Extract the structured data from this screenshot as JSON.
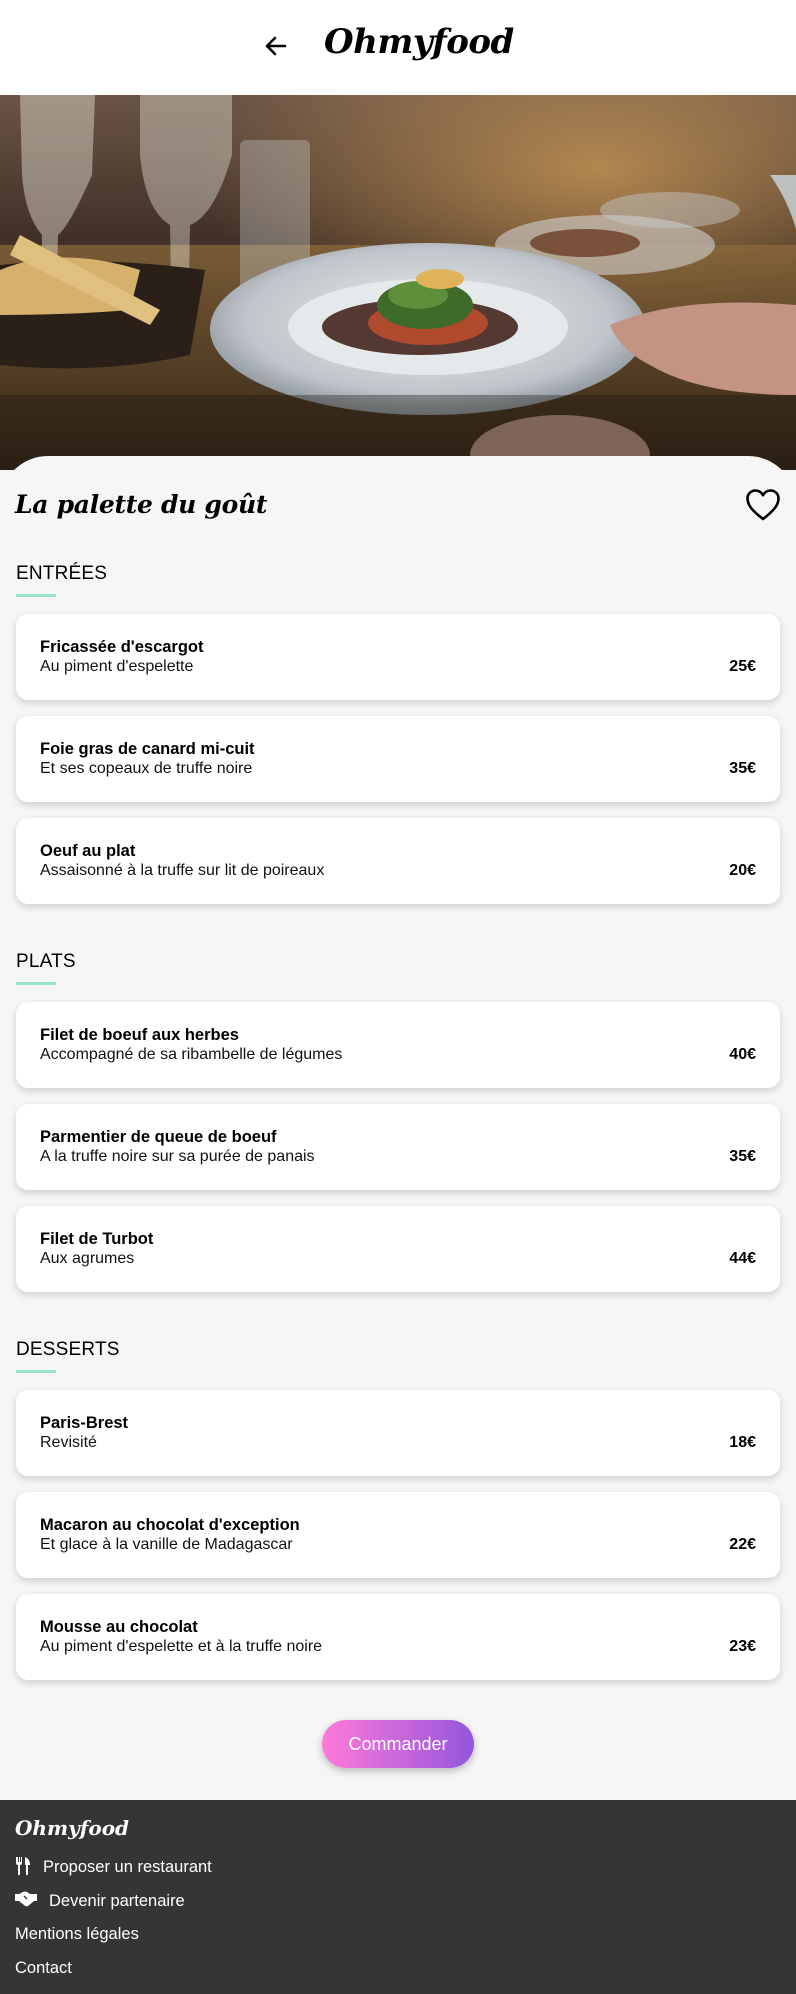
{
  "header": {
    "logo": "Ohmyfood",
    "back_icon": "arrow-left-icon"
  },
  "restaurant": {
    "name": "La palette du goût",
    "favorite_icon": "heart-outline-icon"
  },
  "sections": [
    {
      "title": "ENTRÉES",
      "items": [
        {
          "name": "Fricassée d'escargot",
          "desc": "Au piment d'espelette",
          "price": "25€"
        },
        {
          "name": "Foie gras de canard mi-cuit",
          "desc": "Et ses copeaux de truffe noire",
          "price": "35€"
        },
        {
          "name": "Oeuf au plat",
          "desc": "Assaisonné à la truffe sur lit de poireaux",
          "price": "20€"
        }
      ]
    },
    {
      "title": "PLATS",
      "items": [
        {
          "name": "Filet de boeuf aux herbes",
          "desc": "Accompagné de sa ribambelle de légumes",
          "price": "40€"
        },
        {
          "name": "Parmentier de queue de boeuf",
          "desc": "A la truffe noire sur sa purée de panais",
          "price": "35€"
        },
        {
          "name": "Filet de Turbot",
          "desc": "Aux agrumes",
          "price": "44€"
        }
      ]
    },
    {
      "title": "DESSERTS",
      "items": [
        {
          "name": "Paris-Brest",
          "desc": "Revisité",
          "price": "18€"
        },
        {
          "name": "Macaron au chocolat d'exception",
          "desc": "Et glace à la vanille de Madagascar",
          "price": "22€"
        },
        {
          "name": "Mousse au chocolat",
          "desc": "Au piment d'espelette et à la truffe noire",
          "price": "23€"
        }
      ]
    }
  ],
  "order_button": "Commander",
  "footer": {
    "logo": "Ohmyfood",
    "links": [
      {
        "label": "Proposer un restaurant",
        "icon": "utensils-icon"
      },
      {
        "label": "Devenir partenaire",
        "icon": "handshake-icon"
      },
      {
        "label": "Mentions légales"
      },
      {
        "label": "Contact"
      }
    ]
  },
  "colors": {
    "accent_underline": "#99e2d0",
    "button_gradient_start": "#ff79da",
    "button_gradient_end": "#9356dc",
    "footer_bg": "#353535",
    "page_bg": "#f6f6f6"
  }
}
